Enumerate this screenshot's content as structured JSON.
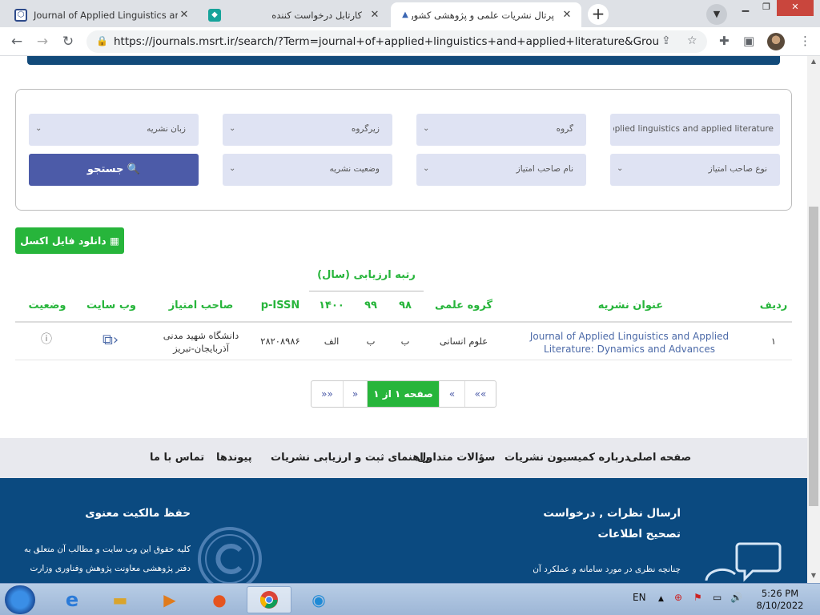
{
  "browser": {
    "tabs": [
      {
        "title": "Journal of Applied Linguistics and Applied",
        "active": false
      },
      {
        "title": "کارتابل درخواست کننده",
        "active": false
      },
      {
        "title": "پرتال نشریات علمی و پژوهشی کشور",
        "active": true
      }
    ],
    "url": "https://journals.msrt.ir/search/?Term=journal+of+applied+linguistics+and+applied+literature&Group=&S..."
  },
  "filters": {
    "term": "f applied linguistics and applied literature",
    "group": "گروه",
    "subgroup": "زیرگروه",
    "language": "زبان نشریه",
    "holder_type": "نوع صاحب امتیاز",
    "holder_name": "نام صاحب امتیاز",
    "status": "وضعیت نشریه",
    "search_label": "جستجو"
  },
  "excel_label": "دانلود فایل اکسل",
  "table": {
    "rank_header": "رتبه ارزیابی (سال)",
    "headers": {
      "row": "ردیف",
      "title": "عنوان نشریه",
      "group": "گروه علمی",
      "y98": "۹۸",
      "y99": "۹۹",
      "y1400": "۱۴۰۰",
      "issn": "p-ISSN",
      "holder": "صاحب امتیاز",
      "website": "وب سایت",
      "status": "وضعیت"
    },
    "rows": [
      {
        "row": "۱",
        "title_line1": "Journal of Applied Linguistics and Applied",
        "title_line2": "Literature: Dynamics and Advances",
        "group": "علوم انسانی",
        "y98": "ب",
        "y99": "ب",
        "y1400": "الف",
        "issn": "۲۸۲۰۸۹۸۶",
        "holder_line1": "دانشگاه شهید مدنی",
        "holder_line2": "آذربایجان-تبریز"
      }
    ]
  },
  "pager": {
    "first": "««",
    "prev": "«",
    "current": "صفحه ۱ از ۱",
    "next": "»",
    "last": "»»"
  },
  "footer_nav": [
    "صفحه اصلی",
    "درباره کمیسیون نشریات",
    "سؤالات متداول",
    "راهنمای ثبت و ارزیابی نشریات",
    "پیوندها",
    "تماس با ما"
  ],
  "footer": {
    "right_title_1": "ارسال نظرات , درخواست",
    "right_title_2": "تصحیح اطلاعات",
    "right_text": "چنانچه نظری در مورد سامانه و عملکرد آن",
    "left_title": "حفظ مالکیت معنوی",
    "left_text_1": "کلیه حقوق این وب سایت و مطالب آن متعلق به",
    "left_text_2": "دفتر پژوهشی معاونت پژوهش وفناوری وزارت"
  },
  "taskbar": {
    "lang": "EN",
    "time": "5:26 PM",
    "date": "8/10/2022"
  },
  "colors": {
    "accent_green": "#27b53b",
    "button_blue": "#4c5ba8",
    "footer_blue": "#0b4a80"
  }
}
